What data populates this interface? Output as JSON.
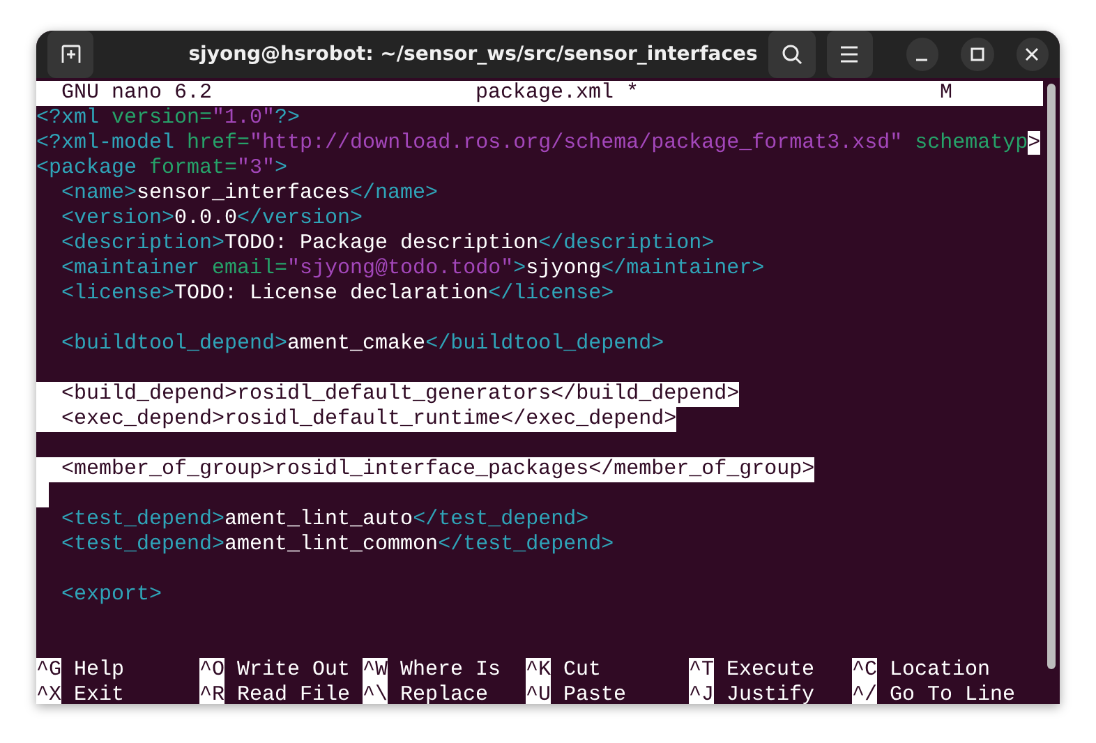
{
  "window": {
    "title": "sjyong@hsrobot: ~/sensor_ws/src/sensor_interfaces"
  },
  "header": {
    "app": "GNU nano 6.2",
    "filename": "package.xml *",
    "flag": "M"
  },
  "lines": [
    {
      "selected": false,
      "segments": [
        {
          "kind": "tag",
          "text": "<?xml "
        },
        {
          "kind": "attr",
          "text": "version="
        },
        {
          "kind": "value",
          "text": "\"1.0\""
        },
        {
          "kind": "tag",
          "text": "?>"
        }
      ]
    },
    {
      "selected": false,
      "segments": [
        {
          "kind": "tag",
          "text": "<?xml-model "
        },
        {
          "kind": "attr",
          "text": "href="
        },
        {
          "kind": "value",
          "text": "\"http://download.ros.org/schema/package_format3.xsd\""
        },
        {
          "kind": "attr",
          "text": " schematyp"
        },
        {
          "kind": "overflow",
          "text": ">"
        }
      ]
    },
    {
      "selected": false,
      "segments": [
        {
          "kind": "tag",
          "text": "<package "
        },
        {
          "kind": "attr",
          "text": "format="
        },
        {
          "kind": "value",
          "text": "\"3\""
        },
        {
          "kind": "tag",
          "text": ">"
        }
      ]
    },
    {
      "selected": false,
      "segments": [
        {
          "kind": "tag",
          "text": "  <name>"
        },
        {
          "kind": "text",
          "text": "sensor_interfaces"
        },
        {
          "kind": "tag",
          "text": "</name>"
        }
      ]
    },
    {
      "selected": false,
      "segments": [
        {
          "kind": "tag",
          "text": "  <version>"
        },
        {
          "kind": "text",
          "text": "0.0.0"
        },
        {
          "kind": "tag",
          "text": "</version>"
        }
      ]
    },
    {
      "selected": false,
      "segments": [
        {
          "kind": "tag",
          "text": "  <description>"
        },
        {
          "kind": "text",
          "text": "TODO: Package description"
        },
        {
          "kind": "tag",
          "text": "</description>"
        }
      ]
    },
    {
      "selected": false,
      "segments": [
        {
          "kind": "tag",
          "text": "  <maintainer "
        },
        {
          "kind": "attr",
          "text": "email="
        },
        {
          "kind": "value",
          "text": "\"sjyong@todo.todo\""
        },
        {
          "kind": "tag",
          "text": ">"
        },
        {
          "kind": "text",
          "text": "sjyong"
        },
        {
          "kind": "tag",
          "text": "</maintainer>"
        }
      ]
    },
    {
      "selected": false,
      "segments": [
        {
          "kind": "tag",
          "text": "  <license>"
        },
        {
          "kind": "text",
          "text": "TODO: License declaration"
        },
        {
          "kind": "tag",
          "text": "</license>"
        }
      ]
    },
    {
      "selected": false
    },
    {
      "selected": false,
      "segments": [
        {
          "kind": "tag",
          "text": "  <buildtool_depend>"
        },
        {
          "kind": "text",
          "text": "ament_cmake"
        },
        {
          "kind": "tag",
          "text": "</buildtool_depend>"
        }
      ]
    },
    {
      "selected": false
    },
    {
      "selected": true,
      "segments": [
        {
          "kind": "tag",
          "text": "  <build_depend>"
        },
        {
          "kind": "text",
          "text": "rosidl_default_generators"
        },
        {
          "kind": "tag",
          "text": "</build_depend>"
        }
      ]
    },
    {
      "selected": true,
      "segments": [
        {
          "kind": "tag",
          "text": "  <exec_depend>"
        },
        {
          "kind": "text",
          "text": "rosidl_default_runtime"
        },
        {
          "kind": "tag",
          "text": "</exec_depend>"
        }
      ]
    },
    {
      "selected": false
    },
    {
      "selected": true,
      "segments": [
        {
          "kind": "tag",
          "text": "  <member_of_group>"
        },
        {
          "kind": "text",
          "text": "rosidl_interface_packages"
        },
        {
          "kind": "tag",
          "text": "</member_of_group>"
        }
      ]
    },
    {
      "selected": true,
      "cursor": true
    },
    {
      "selected": false,
      "segments": [
        {
          "kind": "tag",
          "text": "  <test_depend>"
        },
        {
          "kind": "text",
          "text": "ament_lint_auto"
        },
        {
          "kind": "tag",
          "text": "</test_depend>"
        }
      ]
    },
    {
      "selected": false,
      "segments": [
        {
          "kind": "tag",
          "text": "  <test_depend>"
        },
        {
          "kind": "text",
          "text": "ament_lint_common"
        },
        {
          "kind": "tag",
          "text": "</test_depend>"
        }
      ]
    },
    {
      "selected": false
    },
    {
      "selected": false,
      "segments": [
        {
          "kind": "tag",
          "text": "  <export>"
        }
      ]
    },
    {
      "selected": false
    },
    {
      "selected": false
    }
  ],
  "shortcuts": [
    [
      {
        "key": "^G",
        "label": "Help"
      },
      {
        "key": "^O",
        "label": "Write Out"
      },
      {
        "key": "^W",
        "label": "Where Is"
      },
      {
        "key": "^K",
        "label": "Cut"
      },
      {
        "key": "^T",
        "label": "Execute"
      },
      {
        "key": "^C",
        "label": "Location"
      }
    ],
    [
      {
        "key": "^X",
        "label": "Exit"
      },
      {
        "key": "^R",
        "label": "Read File"
      },
      {
        "key": "^\\",
        "label": "Replace"
      },
      {
        "key": "^U",
        "label": "Paste"
      },
      {
        "key": "^J",
        "label": "Justify"
      },
      {
        "key": "^/",
        "label": "Go To Line"
      }
    ]
  ]
}
